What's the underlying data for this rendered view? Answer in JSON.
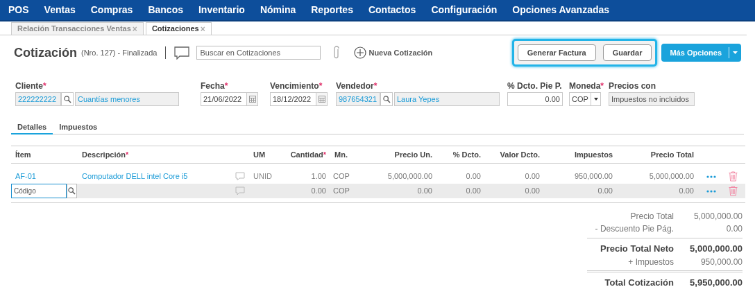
{
  "nav": [
    {
      "label": "POS"
    },
    {
      "label": "Ventas"
    },
    {
      "label": "Compras"
    },
    {
      "label": "Bancos"
    },
    {
      "label": "Inventario"
    },
    {
      "label": "Nómina"
    },
    {
      "label": "Reportes"
    },
    {
      "label": "Contactos"
    },
    {
      "label": "Configuración"
    },
    {
      "label": "Opciones Avanzadas"
    }
  ],
  "doc_tabs": [
    {
      "label": "Relación Transacciones Ventas",
      "close": "×",
      "selected": false
    },
    {
      "label": "Cotizaciones",
      "close": "×",
      "selected": true
    }
  ],
  "header": {
    "title": "Cotización",
    "subtitle": "(Nro. 127) - Finalizada",
    "search_placeholder": "Buscar en Cotizaciones",
    "new_label": "Nueva Cotización"
  },
  "buttons": [
    {
      "label": "Generar Factura",
      "kind": "outline",
      "highlighted": true
    },
    {
      "label": "Guardar",
      "kind": "outline",
      "highlighted": true
    },
    {
      "label": "Más Opciones",
      "kind": "primary",
      "highlighted": false
    }
  ],
  "fields": [
    {
      "label": "Cliente",
      "asterisk": "*",
      "kind": "lookup",
      "code": "222222222",
      "name": "Cuantías menores"
    },
    {
      "label": "Fecha",
      "asterisk": "*",
      "kind": "date",
      "value": "21/06/2022"
    },
    {
      "label": "Vencimiento",
      "asterisk": "*",
      "kind": "date",
      "value": "18/12/2022"
    },
    {
      "label": "Vendedor",
      "asterisk": "*",
      "kind": "lookup",
      "code": "987654321",
      "name": "Laura Yepes"
    },
    {
      "label": "% Dcto. Pie P.",
      "kind": "number",
      "value": "0.00"
    },
    {
      "label": "Moneda",
      "asterisk": "*",
      "kind": "select",
      "value": "COP"
    },
    {
      "label": "Precios con",
      "kind": "readonly",
      "value": "Impuestos no incluidos"
    }
  ],
  "sub_tabs": [
    {
      "label": "Detalles",
      "selected": true
    },
    {
      "label": "Impuestos",
      "selected": false
    }
  ],
  "columns": [
    {
      "label": "Ítem"
    },
    {
      "label": "Descripción",
      "asterisk": "*"
    },
    {
      "label": "UM"
    },
    {
      "label": "Cantidad",
      "asterisk": "*"
    },
    {
      "label": "Mn."
    },
    {
      "label": "Precio Un."
    },
    {
      "label": "% Dcto."
    },
    {
      "label": "Valor Dcto."
    },
    {
      "label": "Impuestos"
    },
    {
      "label": "Precio Total"
    }
  ],
  "rows": [
    {
      "kind": "line",
      "item": "AF-01",
      "description": "Computador DELL intel Core i5",
      "um": "UNID",
      "qty": "1.00",
      "mn": "COP",
      "price": "5,000,000.00",
      "dcto": "0.00",
      "valor": "0.00",
      "tax": "950,000.00",
      "total": "5,000,000.00"
    },
    {
      "kind": "entry",
      "placeholder": "Código",
      "qty": "0.00",
      "mn": "COP",
      "price": "0.00",
      "dcto": "0.00",
      "valor": "0.00",
      "tax": "0.00",
      "total": "0.00"
    }
  ],
  "totals": [
    {
      "label": "Precio Total",
      "value": "5,000,000.00",
      "kind": "normal"
    },
    {
      "label": "- Descuento Pie Pág.",
      "value": "0.00",
      "kind": "normal"
    },
    {
      "label": "Precio Total Neto",
      "value": "5,000,000.00",
      "kind": "bold"
    },
    {
      "label": "+ Impuestos",
      "value": "950,000.00",
      "kind": "normal"
    },
    {
      "label": "Total Cotización",
      "value": "5,950,000.00",
      "kind": "grand"
    }
  ]
}
